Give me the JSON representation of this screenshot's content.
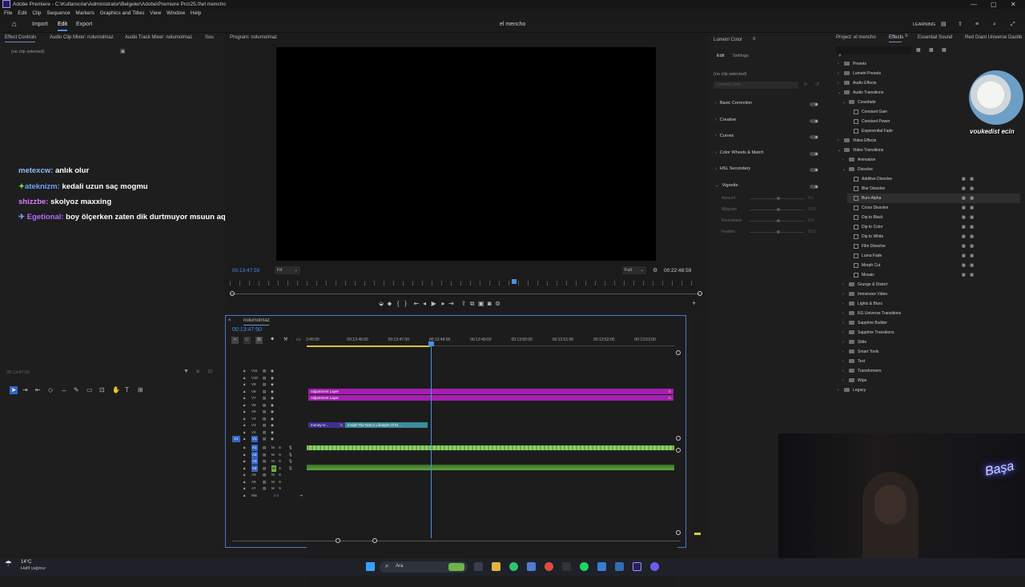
{
  "window": {
    "title": "Adobe Premiere - C:\\Kullanıcılar\\Administrator\\Belgeler\\Adobe\\Premiere Pro\\25.0\\el mencho",
    "menus": [
      "File",
      "Edit",
      "Clip",
      "Sequence",
      "Markers",
      "Graphics and Titles",
      "View",
      "Window",
      "Help"
    ]
  },
  "nav": {
    "import": "Import",
    "edit": "Edit",
    "export": "Export",
    "project_name": "el mencho",
    "workspace": "LEARNING"
  },
  "left_panel": {
    "tabs": [
      "Effect Controls",
      "Audio Clip Mixer: nolurnolmaz",
      "Audio Track Mixer: nolurnolmaz",
      "Sou"
    ],
    "no_clip": "(no clip selected)",
    "timecode": "00:13:47:50"
  },
  "chat": [
    {
      "user": "metexcw:",
      "msg": "anlık olur",
      "color": "#8fb9ff",
      "badge": ""
    },
    {
      "user": "ateknizm:",
      "msg": "kedali uzun saç mogmu",
      "color": "#6da3ff",
      "badge": "✦"
    },
    {
      "user": "shizzbe:",
      "msg": "skolyoz maxxing",
      "color": "#e07bff",
      "badge": ""
    },
    {
      "user": "Egetional:",
      "msg": "boy ölçerken zaten dik durtmuyor msuun aq",
      "color": "#b06cff",
      "badge": "✈"
    }
  ],
  "program_monitor": {
    "title": "Program: nolurnolmaz",
    "timecode": "00:13:47:50",
    "fit": "Fit",
    "quality": "Full",
    "duration": "00:22:48:59"
  },
  "timeline": {
    "name": "nolurnolmaz",
    "timecode": "00:13:47:50",
    "ruler": [
      "3:45:00",
      "00:13:46:00",
      "00:13:47:00",
      "00:13:48:00",
      "00:13:49:00",
      "00:13:50:00",
      "00:13:51:00",
      "00:13:52:00",
      "00:13:53:00"
    ],
    "video_tracks": [
      "V11",
      "V10",
      "V9",
      "V8",
      "V7",
      "V6",
      "V5",
      "V4",
      "V3",
      "V2",
      "V1"
    ],
    "audio_tracks": [
      "A1",
      "A2",
      "A3",
      "A4",
      "A5",
      "A6",
      "A7"
    ],
    "mix": "Mix",
    "mix_value": "0.0",
    "clips": {
      "adj1": "Adjustment Layer",
      "adj2": "Adjustment Layer",
      "clip_a": "money-cr...",
      "clip_b": "Inside The Narco Lifestyle Of El..."
    }
  },
  "lumetri": {
    "title": "Lumetri Color",
    "tabs": [
      "Edit",
      "Settings"
    ],
    "no_clip": "(no clip selected)",
    "dropdown": "Lumetri Color",
    "sections": [
      "Basic Correction",
      "Creative",
      "Curves",
      "Color Wheels & Match",
      "HSL Secondary",
      "Vignette"
    ],
    "vignette": [
      {
        "label": "Amount",
        "value": "0.0"
      },
      {
        "label": "Midpoint",
        "value": "50.0"
      },
      {
        "label": "Roundness",
        "value": "0.0"
      },
      {
        "label": "Feather",
        "value": "50.0"
      }
    ]
  },
  "effects_panel": {
    "tabs": [
      "Project: el mencho",
      "Effects",
      "Essential Sound",
      "Red Giant Universe Dashb"
    ],
    "tree": [
      {
        "label": "Presets",
        "depth": 0,
        "kind": "folder",
        "open": false
      },
      {
        "label": "Lumetri Presets",
        "depth": 0,
        "kind": "folder",
        "open": false
      },
      {
        "label": "Audio Effects",
        "depth": 0,
        "kind": "folder",
        "open": false
      },
      {
        "label": "Audio Transitions",
        "depth": 0,
        "kind": "folder",
        "open": true
      },
      {
        "label": "Crossfade",
        "depth": 1,
        "kind": "folder",
        "open": true
      },
      {
        "label": "Constant Gain",
        "depth": 2,
        "kind": "fx"
      },
      {
        "label": "Constant Power",
        "depth": 2,
        "kind": "fx"
      },
      {
        "label": "Exponential Fade",
        "depth": 2,
        "kind": "fx"
      },
      {
        "label": "Video Effects",
        "depth": 0,
        "kind": "folder",
        "open": false
      },
      {
        "label": "Video Transitions",
        "depth": 0,
        "kind": "folder",
        "open": true
      },
      {
        "label": "Animation",
        "depth": 1,
        "kind": "folder",
        "open": false
      },
      {
        "label": "Dissolve",
        "depth": 1,
        "kind": "folder",
        "open": true
      },
      {
        "label": "Additive Dissolve",
        "depth": 2,
        "kind": "fx",
        "badges": true
      },
      {
        "label": "Blur Dissolve",
        "depth": 2,
        "kind": "fx",
        "badges": true
      },
      {
        "label": "Burn Alpha",
        "depth": 2,
        "kind": "fx",
        "badges": true,
        "selected": true
      },
      {
        "label": "Cross Dissolve",
        "depth": 2,
        "kind": "fx",
        "badges": true
      },
      {
        "label": "Dip to Black",
        "depth": 2,
        "kind": "fx",
        "badges": true
      },
      {
        "label": "Dip to Color",
        "depth": 2,
        "kind": "fx",
        "badges": true
      },
      {
        "label": "Dip to White",
        "depth": 2,
        "kind": "fx",
        "badges": true
      },
      {
        "label": "Film Dissolve",
        "depth": 2,
        "kind": "fx",
        "badges": true
      },
      {
        "label": "Luma Fade",
        "depth": 2,
        "kind": "fx",
        "badges": true
      },
      {
        "label": "Morph Cut",
        "depth": 2,
        "kind": "fx",
        "badges": true
      },
      {
        "label": "Mosaic",
        "depth": 2,
        "kind": "fx",
        "badges": true
      },
      {
        "label": "Grunge & Distort",
        "depth": 1,
        "kind": "folder",
        "open": false
      },
      {
        "label": "Immersive Video",
        "depth": 1,
        "kind": "folder",
        "open": false
      },
      {
        "label": "Lights & Blurs",
        "depth": 1,
        "kind": "folder",
        "open": false
      },
      {
        "label": "RG Universe Transitions",
        "depth": 1,
        "kind": "folder",
        "open": false
      },
      {
        "label": "Sapphire Builder",
        "depth": 1,
        "kind": "folder",
        "open": false
      },
      {
        "label": "Sapphire Transitions",
        "depth": 1,
        "kind": "folder",
        "open": false
      },
      {
        "label": "Slide",
        "depth": 1,
        "kind": "folder",
        "open": false
      },
      {
        "label": "Smart Tools",
        "depth": 1,
        "kind": "folder",
        "open": false
      },
      {
        "label": "Text",
        "depth": 1,
        "kind": "folder",
        "open": false
      },
      {
        "label": "Transformers",
        "depth": 1,
        "kind": "folder",
        "open": false
      },
      {
        "label": "Wipe",
        "depth": 1,
        "kind": "folder",
        "open": false
      },
      {
        "label": "Legacy",
        "depth": 0,
        "kind": "folder",
        "open": false
      }
    ]
  },
  "overlay": {
    "cat_caption": "voukedist ecin",
    "neon": "Başa"
  },
  "taskbar": {
    "weather_temp": "14°C",
    "weather_desc": "Hafif yağmur",
    "search": "Ara"
  },
  "colors": {
    "accent": "#4b8bf5",
    "adjustment": "#a51fb1",
    "audio": "#6fb34a",
    "playhead": "#4a90e2"
  }
}
